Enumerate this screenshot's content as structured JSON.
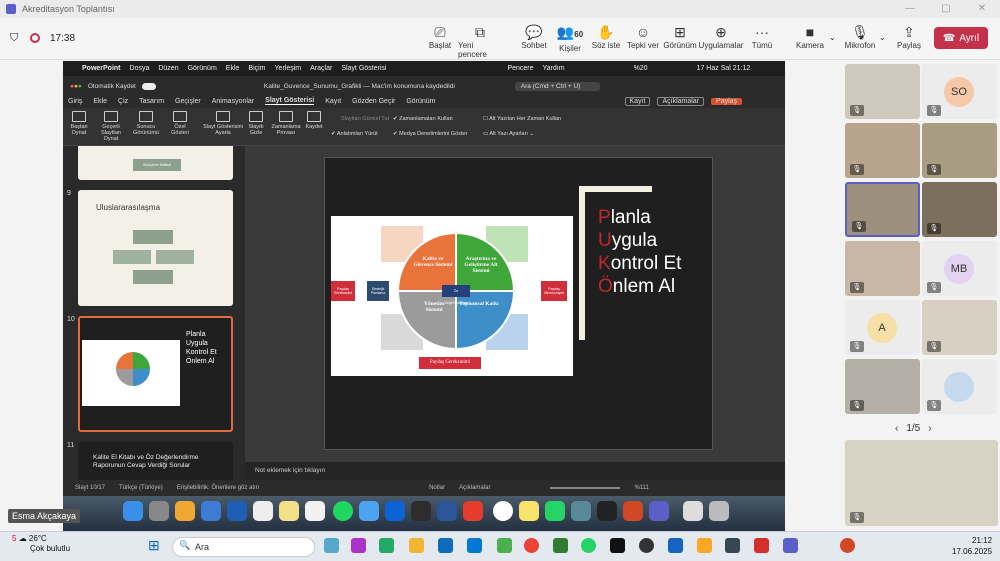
{
  "window": {
    "title": "Akreditasyon Toplantısı"
  },
  "meeting": {
    "timer": "17:38",
    "buttons": [
      {
        "label": "Başlat"
      },
      {
        "label": "Yeni pencere"
      },
      {
        "label": "Sohbet"
      },
      {
        "label": "Kişiler",
        "count": "60"
      },
      {
        "label": "Söz iste"
      },
      {
        "label": "Tepki ver"
      },
      {
        "label": "Görünüm"
      },
      {
        "label": "Uygulamalar"
      },
      {
        "label": "Tümü"
      },
      {
        "label": "Kamera"
      },
      {
        "label": "Mikrofon"
      },
      {
        "label": "Paylaş"
      }
    ],
    "leave": "Ayrıl"
  },
  "mac": {
    "app": "PowerPoint",
    "menus": [
      "Dosya",
      "Düzen",
      "Görünüm",
      "Ekle",
      "Biçim",
      "Yerleşim",
      "Araçlar",
      "Slayt Gösterisi"
    ],
    "right": [
      "Pencere",
      "Yardım"
    ],
    "battery": "%20",
    "datetime": "17 Haz Sal  21:12"
  },
  "ppt": {
    "autosave": "Otomatik Kaydet",
    "filename": "Kalite_Guvence_Sunumu_Grafikli — Mac'im konumuna kaydedildi",
    "search": "Ara (Cmd + Ctrl + U)",
    "tabs": [
      "Giriş",
      "Ekle",
      "Çiz",
      "Tasarım",
      "Geçişler",
      "Animasyonlar",
      "Slayt Gösterisi",
      "Kayıt",
      "Gözden Geçir",
      "Görünüm"
    ],
    "tab_buttons": [
      "Kayıt",
      "Açıklamalar",
      "Paylaş"
    ],
    "ribbon": [
      "Baştan Oynat",
      "Geçerli Slayttan Oynat",
      "Sunucu Görünümü",
      "Özel Gösteri",
      "Slayt Gösterisini Ayarla",
      "Slaydı Gizle",
      "Zamanlama Provası",
      "Kaydet"
    ],
    "checks": [
      "Slaytları Güncel Tut",
      "Zamanlamaları Kullan",
      "Anlatımları Yürüt",
      "Medya Denetimlerini Göster",
      "Alt Yazıları Her Zaman Kullan",
      "Alt Yazı Ayarları"
    ],
    "thumbs": [
      {
        "num": "9",
        "title": "Uluslararasılaşma"
      },
      {
        "num": "10",
        "title": "Planla Uygula Kontrol Et Önlem Al"
      },
      {
        "num": "11",
        "title": "Kalite El Kitabı ve Öz Değerlendirme Raporunun Cevap Verdiği Sorular"
      }
    ],
    "prev_caption": "Süreçlerin Kalitesi",
    "slide": {
      "lines": [
        "Planla",
        "Uygula",
        "Kontrol Et",
        "Önlem Al"
      ],
      "q1": "Kalite ve Güvence Sistemi",
      "q2": "Araştırma ve Geliştirme Alt Sistemi",
      "q3": "Yönetim Sistemi",
      "q4": "Toplumsal Katkı",
      "center": "Öz Değerlendirme",
      "left_box": "Paydaş Gereksinimi",
      "left_box2": "Stratejik Planlama",
      "right_box": "Paydaş Memnuniyeti",
      "bottom": "Paydaş Gereksinimi",
      "puko": [
        "P",
        "U",
        "K",
        "Ö"
      ]
    },
    "notes": "Not eklemek için tıklayın",
    "status": {
      "slide": "Slayt 10/17",
      "lang": "Türkçe (Türkiye)",
      "access": "Erişilebilirlik: Önerilere göz atın",
      "notes": "Notlar",
      "comments": "Açıklamalar",
      "zoom": "%111"
    }
  },
  "participants": [
    {
      "initials": "SO"
    },
    {
      "initials": "MB"
    },
    {
      "initials": "A"
    }
  ],
  "pager": "1/5",
  "self": {
    "name": "Esma Akçakaya"
  },
  "taskbar": {
    "temp": "26°C",
    "weather": "Çok bulutlu",
    "search": "Ara",
    "time": "21:12",
    "date": "17.06.2025",
    "badge": "5"
  },
  "colors": {
    "leave": "#c4314b",
    "q1": "#e8743b",
    "q2": "#3fa63a",
    "q3": "#9b9b9b",
    "q4": "#3e8ec9",
    "puko": "#c0272d"
  }
}
